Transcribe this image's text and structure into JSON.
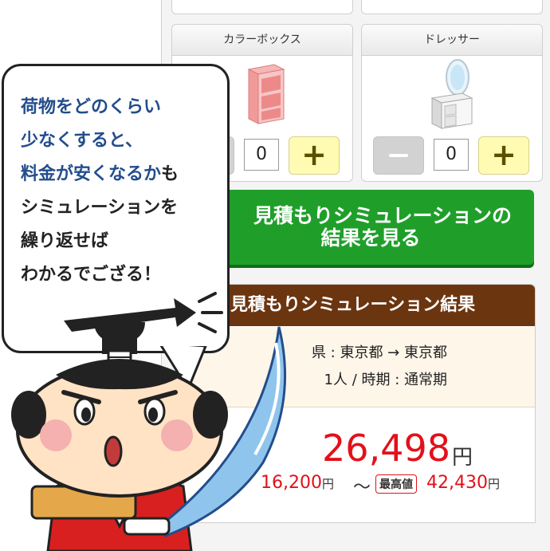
{
  "items": [
    {
      "name": "カラーボックス",
      "qty": "0",
      "icon": "color-box-icon"
    },
    {
      "name": "ドレッサー",
      "qty": "0",
      "icon": "dresser-icon"
    }
  ],
  "buttons": {
    "plus": "+",
    "minus": "−"
  },
  "simulation_button": {
    "line1": "見積もりシミュレーションの",
    "line2": "結果を見る"
  },
  "result": {
    "title": "見積もりシミュレーション結果",
    "route": "県 : 東京都 → 東京都",
    "people_period": "1人 / 時期 : 通常期",
    "price": "26,498",
    "yen": "円",
    "min_price": "16,200",
    "tilde": "〜",
    "max_label": "最高値",
    "max_price": "42,430"
  },
  "bubble": {
    "line1": "荷物をどのくらい",
    "line2": "少なくすると、",
    "line3a": "料金が安くなるか",
    "line3b": "も",
    "line4": "シミュレーションを",
    "line5": "繰り返せば",
    "line6": "わかるでござる！"
  },
  "colors": {
    "accent_green": "#1f9f2a",
    "header_brown": "#6b3510",
    "price_red": "#e3101a",
    "text_blue": "#234d8c"
  }
}
